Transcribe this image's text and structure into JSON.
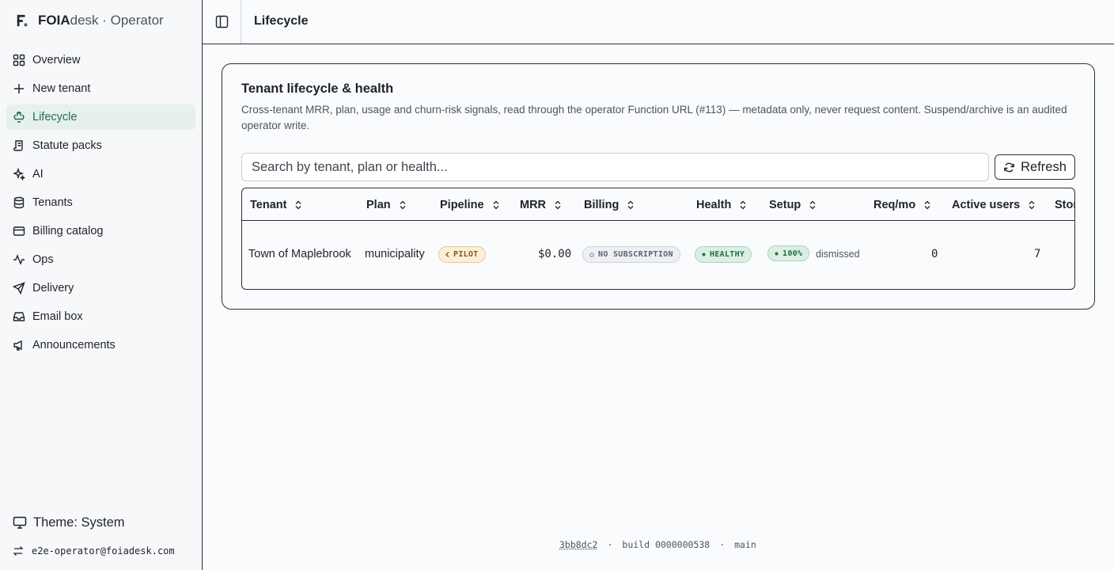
{
  "sidebar": {
    "brand_bold": "FOIA",
    "brand_rest": "desk · Operator",
    "items": [
      {
        "label": "Overview",
        "icon": "grid-icon"
      },
      {
        "label": "New tenant",
        "icon": "plus-icon"
      },
      {
        "label": "Lifecycle",
        "icon": "recycle-icon",
        "active": true
      },
      {
        "label": "Statute packs",
        "icon": "scroll-icon"
      },
      {
        "label": "AI",
        "icon": "sparkles-icon"
      },
      {
        "label": "Tenants",
        "icon": "database-icon"
      },
      {
        "label": "Billing catalog",
        "icon": "credit-card-icon"
      },
      {
        "label": "Ops",
        "icon": "activity-icon"
      },
      {
        "label": "Delivery",
        "icon": "send-icon"
      },
      {
        "label": "Email box",
        "icon": "inbox-icon"
      },
      {
        "label": "Announcements",
        "icon": "megaphone-icon"
      }
    ],
    "theme_label": "Theme: System",
    "user_email": "e2e-operator@foiadesk.com"
  },
  "header": {
    "title": "Lifecycle"
  },
  "card": {
    "title": "Tenant lifecycle & health",
    "description": "Cross-tenant MRR, plan, usage and churn-risk signals, read through the operator Function URL (#113) — metadata only, never request content. Suspend/archive is an audited operator write.",
    "search_placeholder": "Search by tenant, plan or health...",
    "refresh_label": "Refresh"
  },
  "table": {
    "columns": [
      "Tenant",
      "Plan",
      "Pipeline",
      "MRR",
      "Billing",
      "Health",
      "Setup",
      "Req/mo",
      "Active users",
      "Storage"
    ],
    "rows": [
      {
        "tenant": "Town of Maplebrook",
        "plan": "municipality",
        "pipeline": "PILOT",
        "mrr": "$0.00",
        "billing": "NO SUBSCRIPTION",
        "health": "HEALTHY",
        "setup_pct": "100%",
        "setup_note": "dismissed",
        "req_mo": "0",
        "active_users": "7"
      }
    ]
  },
  "footer": {
    "commit": "3bb8dc2",
    "build": "build 0000000538",
    "branch": "main",
    "sep": "·"
  },
  "colors": {
    "accent": "#1f6f55",
    "active_bg": "#e6f0ec",
    "pilot": "#8a5a12",
    "healthy": "#1f6f45"
  }
}
